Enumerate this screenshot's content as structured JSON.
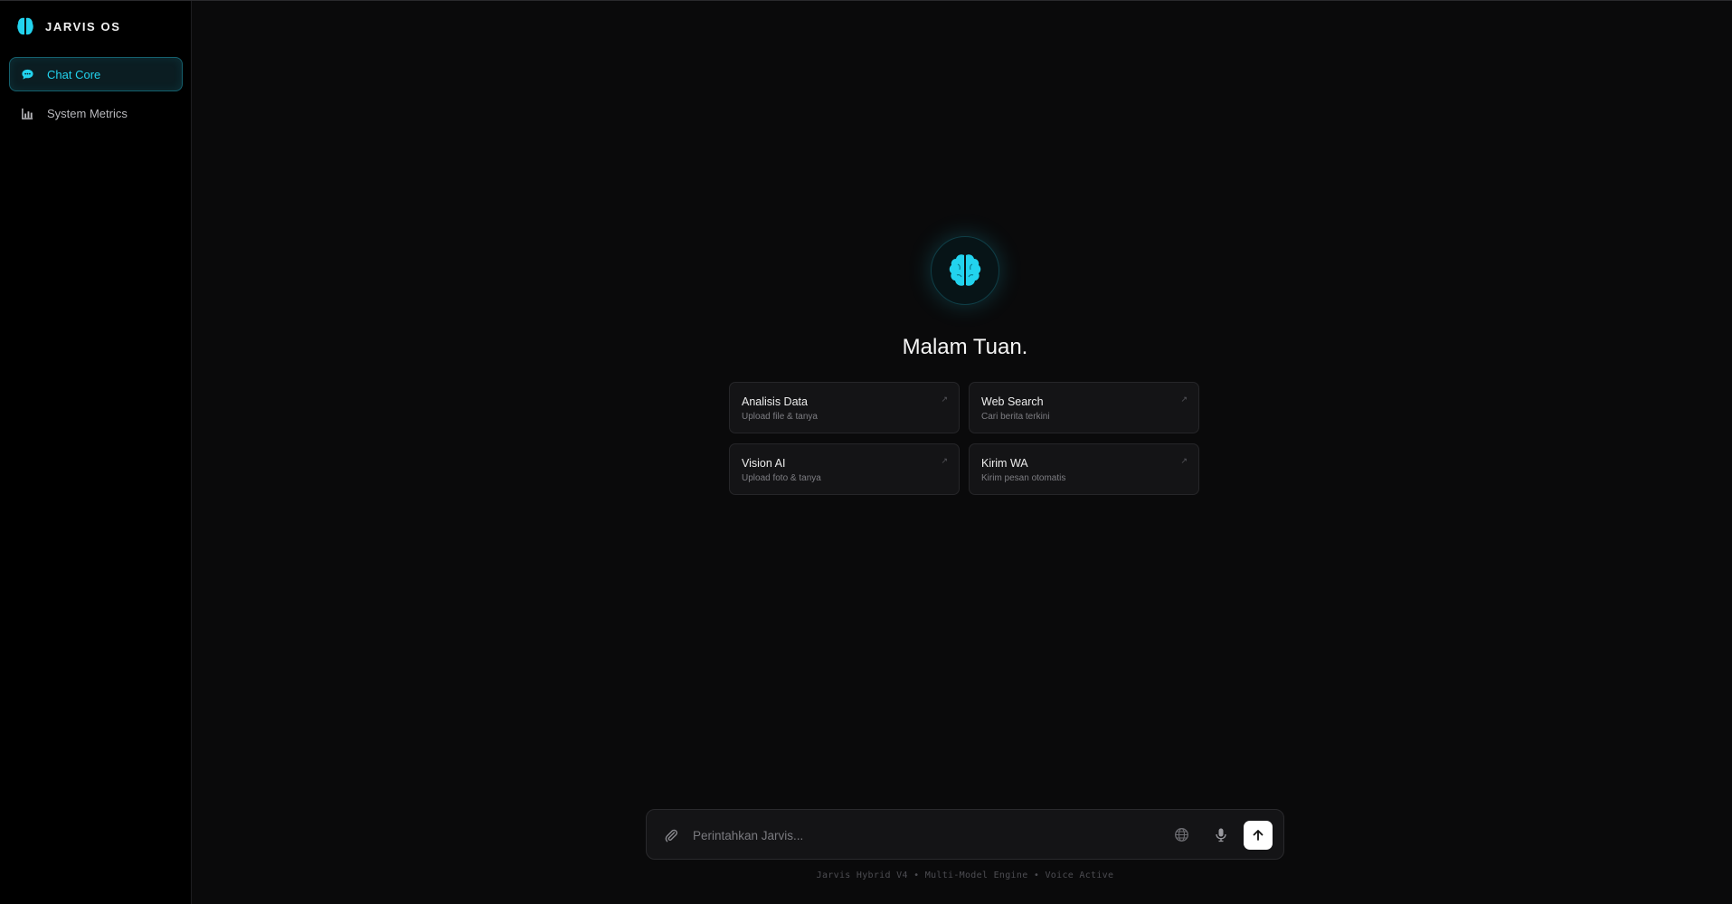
{
  "app": {
    "name": "JARVIS OS",
    "accent": "#22d3ee"
  },
  "sidebar": {
    "items": [
      {
        "label": "Chat Core",
        "icon": "chat-bubble-icon",
        "active": true
      },
      {
        "label": "System Metrics",
        "icon": "bar-chart-icon",
        "active": false
      }
    ]
  },
  "main": {
    "greeting": "Malam Tuan.",
    "cards": [
      {
        "title": "Analisis Data",
        "subtitle": "Upload file & tanya",
        "icon": "arrow-up-right-icon"
      },
      {
        "title": "Web Search",
        "subtitle": "Cari berita terkini",
        "icon": "arrow-up-right-icon"
      },
      {
        "title": "Vision AI",
        "subtitle": "Upload foto & tanya",
        "icon": "arrow-up-right-icon"
      },
      {
        "title": "Kirim WA",
        "subtitle": "Kirim pesan otomatis",
        "icon": "arrow-up-right-icon"
      }
    ]
  },
  "composer": {
    "placeholder": "Perintahkan Jarvis...",
    "value": "",
    "footer": "Jarvis Hybrid V4 • Multi-Model Engine • Voice Active"
  }
}
